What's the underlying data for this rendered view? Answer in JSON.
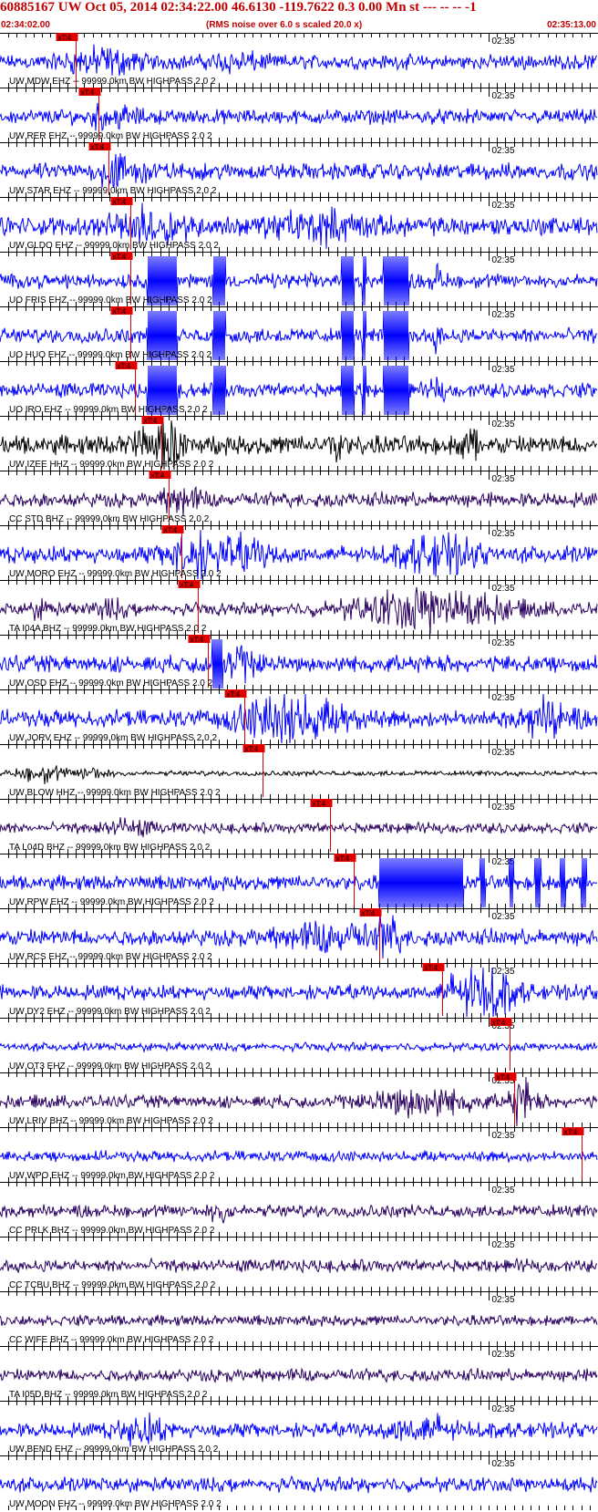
{
  "header": {
    "title": "60885167 UW Oct 05, 2014 02:34:22.00   46.6130 -119.7622  0.3 0.00 Mn st --- -- --  -1",
    "start_time": "02:34:02.00",
    "subtitle": "(RMS noise over 6.0 s scaled 20.0 x)",
    "end_time": "02:35:13.00"
  },
  "chart_data": {
    "type": "line",
    "title": "60885167 UW Oct 05, 2014 02:34:22.00   46.6130 -119.7622  0.3 0.00 Mn st --- -- --  -1",
    "subtitle": "(RMS noise over 6.0 s scaled 20.0 x)",
    "x_start": "02:34:02.00",
    "x_end": "02:35:13.00",
    "x_range_seconds": [
      0,
      71
    ],
    "minute_mark_label": "02:35",
    "minute_mark_seconds": 58,
    "pick_label": "xT:4",
    "pick_color": "#e00000",
    "grid": false,
    "channels": [
      {
        "label": "UW MDW EHZ -- 99999.0km BW  HIGHPASS  2.0  2",
        "pick_s": 9.0,
        "color": "#0000ff",
        "amp": 0.35,
        "events": [
          [
            12,
            0.5,
            6
          ],
          [
            28,
            0.3,
            4
          ]
        ]
      },
      {
        "label": "UW RER EHZ -- 99999.0km BW  HIGHPASS  2.0  2",
        "pick_s": 11.7,
        "color": "#0000ff",
        "amp": 0.35,
        "events": [
          [
            13,
            0.4,
            4
          ]
        ]
      },
      {
        "label": "UW STAR EHZ -- 99999.0km BW  HIGHPASS  2.0  2",
        "pick_s": 12.9,
        "color": "#0000ff",
        "amp": 0.4,
        "events": [
          [
            13.5,
            0.9,
            2
          ],
          [
            16,
            0.4,
            4
          ]
        ]
      },
      {
        "label": "UW GLDO EHZ -- 99999.0km BW  HIGHPASS  2.0  2",
        "pick_s": 15.5,
        "color": "#0000ff",
        "amp": 0.45,
        "events": [
          [
            18,
            0.6,
            6
          ],
          [
            38,
            0.5,
            8
          ]
        ]
      },
      {
        "label": "UO FRIS EHZ -- 99999.0km BW  HIGHPASS  2.0  2",
        "pick_s": 15.5,
        "color": "#0000ff",
        "amp": 0.35,
        "clips": [
          [
            17.5,
            21
          ],
          [
            25.3,
            26.8
          ],
          [
            40.5,
            42
          ],
          [
            43,
            43.5
          ],
          [
            45.5,
            48.5
          ]
        ],
        "events": [
          [
            52,
            0.6,
            1
          ]
        ]
      },
      {
        "label": "UO HUO EHZ -- 99999.0km BW  HIGHPASS  2.0  2",
        "pick_s": 15.5,
        "color": "#0000ff",
        "amp": 0.35,
        "clips": [
          [
            17.5,
            21
          ],
          [
            25.3,
            26.8
          ],
          [
            40.5,
            42
          ],
          [
            43,
            43.5
          ],
          [
            45.5,
            48.5
          ]
        ],
        "events": [
          [
            52,
            0.5,
            1
          ]
        ]
      },
      {
        "label": "UO IRO EHZ -- 99999.0km BW  HIGHPASS  2.0  2",
        "pick_s": 16.0,
        "color": "#0000ff",
        "amp": 0.35,
        "clips": [
          [
            17.5,
            21
          ],
          [
            25.3,
            26.8
          ],
          [
            40.5,
            42
          ],
          [
            43,
            43.5
          ],
          [
            45.5,
            48.5
          ]
        ],
        "events": [
          [
            52,
            0.5,
            1
          ]
        ]
      },
      {
        "label": "UW IZEE HHZ -- 99999.0km BW  HIGHPASS  2.0  2",
        "pick_s": 19.2,
        "color": "#000000",
        "amp": 0.45,
        "events": [
          [
            20,
            1.2,
            2
          ],
          [
            16.5,
            0.6,
            2
          ],
          [
            40,
            0.8,
            1
          ],
          [
            56,
            0.6,
            2
          ]
        ]
      },
      {
        "label": "CC STD BHZ -- 99999.0km BW  HIGHPASS  2.0  2",
        "pick_s": 20.0,
        "color": "#2a0060",
        "amp": 0.35,
        "events": [
          [
            21.5,
            0.5,
            3
          ]
        ]
      },
      {
        "label": "UW MORO EHZ -- 99999.0km BW  HIGHPASS  2.0  2",
        "pick_s": 21.5,
        "color": "#0000ff",
        "amp": 0.4,
        "events": [
          [
            23,
            1.0,
            4
          ],
          [
            28,
            0.6,
            6
          ],
          [
            52,
            0.7,
            6
          ]
        ]
      },
      {
        "label": "TA I04A BHZ -- 99999.0km BW  HIGHPASS  2.0  2",
        "pick_s": 23.5,
        "color": "#2a0060",
        "amp": 0.3,
        "events": [
          [
            5,
            0.3,
            2
          ],
          [
            13,
            0.3,
            3
          ],
          [
            51,
            0.9,
            12
          ]
        ]
      },
      {
        "label": "UW OSD EHZ -- 99999.0km BW  HIGHPASS  2.0  2",
        "pick_s": 24.7,
        "color": "#0000ff",
        "amp": 0.4,
        "clips": [
          [
            25.2,
            26.5
          ]
        ],
        "events": [
          [
            28,
            0.6,
            4
          ]
        ]
      },
      {
        "label": "UW JORV EHZ -- 99999.0km BW  HIGHPASS  2.0  2",
        "pick_s": 29.0,
        "color": "#0000ff",
        "amp": 0.4,
        "events": [
          [
            34,
            1.2,
            7
          ],
          [
            41,
            0.4,
            4
          ],
          [
            65,
            0.8,
            4
          ]
        ]
      },
      {
        "label": "UW BLOW HHZ -- 99999.0km BW  HIGHPASS  2.0  2",
        "pick_s": 31.2,
        "color": "#000000",
        "amp": 0.12,
        "events": [
          [
            5,
            0.4,
            4
          ],
          [
            11,
            0.3,
            3
          ]
        ]
      },
      {
        "label": "TA L04D BHZ -- 99999.0km BW  HIGHPASS  2.0  2",
        "pick_s": 39.2,
        "color": "#2a0060",
        "amp": 0.25,
        "events": [
          [
            15,
            0.3,
            4
          ]
        ]
      },
      {
        "label": "UW RPW EHZ -- 99999.0km BW  HIGHPASS  2.0  2",
        "pick_s": 42.0,
        "color": "#0000ff",
        "amp": 0.35,
        "clips": [
          [
            45.0,
            55.0
          ],
          [
            57,
            57.6
          ],
          [
            60.5,
            61
          ],
          [
            63.5,
            64.2
          ],
          [
            66.5,
            67.2
          ],
          [
            69,
            69.6
          ]
        ]
      },
      {
        "label": "UW RCS EHZ -- 99999.0km BW  HIGHPASS  2.0  2",
        "pick_s": 45.0,
        "color": "#0000ff",
        "amp": 0.4,
        "events": [
          [
            46,
            1.0,
            2
          ],
          [
            40,
            0.5,
            8
          ]
        ]
      },
      {
        "label": "UW DY2 EHZ -- 99999.0km BW  HIGHPASS  2.0  2",
        "pick_s": 52.5,
        "color": "#0000ff",
        "amp": 0.35,
        "events": [
          [
            57,
            1.3,
            5
          ]
        ]
      },
      {
        "label": "UW OT3 EHZ -- 99999.0km BW  HIGHPASS  2.0  2",
        "pick_s": 60.5,
        "color": "#0000ff",
        "amp": 0.2,
        "events": []
      },
      {
        "label": "UW LRIV BHZ -- 99999.0km BW  HIGHPASS  2.0  2",
        "pick_s": 61.0,
        "color": "#2a0060",
        "amp": 0.3,
        "events": [
          [
            50,
            0.6,
            8
          ],
          [
            62,
            1.0,
            2
          ]
        ]
      },
      {
        "label": "UW WPO EHZ -- 99999.0km BW  HIGHPASS  2.0  2",
        "pick_s": 69.0,
        "color": "#0000ff",
        "amp": 0.25,
        "events": []
      },
      {
        "label": "CC PRLK BHZ -- 99999.0km BW  HIGHPASS  2.0  2",
        "pick_s": null,
        "color": "#2a0060",
        "amp": 0.3,
        "events": [
          [
            26,
            0.4,
            2
          ]
        ]
      },
      {
        "label": "CC TCBU BHZ -- 99999.0km BW  HIGHPASS  2.0  2",
        "pick_s": null,
        "color": "#2a0060",
        "amp": 0.3,
        "events": []
      },
      {
        "label": "CC WIFE BHZ -- 99999.0km BW  HIGHPASS  2.0  2",
        "pick_s": null,
        "color": "#2a0060",
        "amp": 0.25,
        "events": []
      },
      {
        "label": "TA I05D BHZ -- 99999.0km BW  HIGHPASS  2.0  2",
        "pick_s": null,
        "color": "#2a0060",
        "amp": 0.3,
        "events": []
      },
      {
        "label": "UW BEND EHZ -- 99999.0km BW  HIGHPASS  2.0  2",
        "pick_s": null,
        "color": "#0000ff",
        "amp": 0.35,
        "events": [
          [
            17,
            0.5,
            4
          ],
          [
            50,
            0.5,
            6
          ]
        ]
      },
      {
        "label": "UW MOON EHZ -- 99999.0km BW  HIGHPASS  2.0  2",
        "pick_s": null,
        "color": "#0000ff",
        "amp": 0.35,
        "events": []
      }
    ]
  }
}
